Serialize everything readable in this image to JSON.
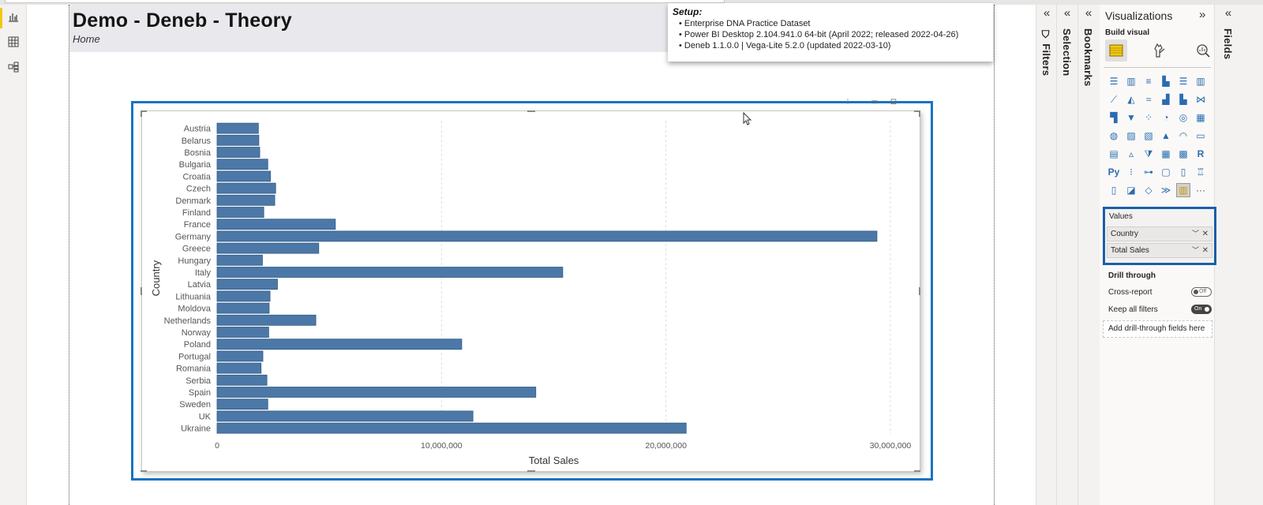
{
  "report": {
    "title": "Demo - Deneb - Theory",
    "subtitle": "Home"
  },
  "left_nav": [
    {
      "name": "report-view",
      "icon": "bar-chart-icon",
      "active": true
    },
    {
      "name": "data-view",
      "icon": "table-icon",
      "active": false
    },
    {
      "name": "model-view",
      "icon": "model-icon",
      "active": false
    }
  ],
  "setup_note": {
    "heading": "Setup:",
    "items": [
      "Enterprise DNA Practice Dataset",
      "Power BI Desktop 2.104.941.0 64-bit (April 2022; released 2022-04-26)",
      "Deneb 1.1.0.0 | Vega-Lite 5.2.0 (updated 2022-03-10)"
    ]
  },
  "visual_header": {
    "icons": [
      "filter-icon",
      "focus-mode-icon",
      "more-options-icon"
    ]
  },
  "panes": {
    "filters": {
      "label": "Filters",
      "collapse": "«"
    },
    "selection": {
      "label": "Selection",
      "collapse": "«"
    },
    "bookmarks": {
      "label": "Bookmarks",
      "collapse": "«"
    },
    "fields": {
      "label": "Fields",
      "collapse": "«"
    },
    "visualizations": {
      "title": "Visualizations",
      "expand": "»",
      "collapse": "«",
      "build_label": "Build visual",
      "tabs": [
        {
          "name": "fields-tab",
          "icon": "fields-icon",
          "active": true
        },
        {
          "name": "format-tab",
          "icon": "format-brush-icon",
          "active": false
        },
        {
          "name": "analytics-tab",
          "icon": "analytics-icon",
          "active": false
        }
      ],
      "visual_types": [
        "stacked-bar",
        "stacked-column",
        "clustered-bar",
        "clustered-column",
        "100-stacked-bar",
        "100-stacked-column",
        "line",
        "area",
        "stacked-area",
        "line-clustered-column",
        "line-stacked-column",
        "ribbon",
        "waterfall",
        "funnel",
        "scatter",
        "pie",
        "donut",
        "treemap",
        "map",
        "filled-map",
        "shape-map",
        "azure-map",
        "gauge",
        "card",
        "multi-row-card",
        "kpi",
        "slicer",
        "table",
        "matrix",
        "r-visual",
        "python-visual",
        "key-influencers",
        "decomposition-tree",
        "qa",
        "smart-narrative",
        "metrics",
        "paginated-report",
        "power-apps",
        "power-automate",
        "narrative",
        "deneb",
        "more"
      ],
      "selected_visual": "deneb",
      "values_label": "Values",
      "values_fields": [
        "Country",
        "Total Sales"
      ],
      "drill_through_label": "Drill through",
      "cross_report_label": "Cross-report",
      "cross_report_state": "Off",
      "keep_filters_label": "Keep all filters",
      "keep_filters_state": "On",
      "drill_drop_label": "Add drill-through fields here"
    }
  },
  "chart_data": {
    "type": "bar",
    "orientation": "horizontal",
    "title": "",
    "xlabel": "Total Sales",
    "ylabel": "Country",
    "xlim": [
      0,
      30000000
    ],
    "xticks": [
      0,
      10000000,
      20000000,
      30000000
    ],
    "xtick_labels": [
      "0",
      "10,000,000",
      "20,000,000",
      "30,000,000"
    ],
    "grid": "vertical dashed",
    "bar_color": "#4c78a8",
    "categories": [
      "Austria",
      "Belarus",
      "Bosnia",
      "Bulgaria",
      "Croatia",
      "Czech",
      "Denmark",
      "Finland",
      "France",
      "Germany",
      "Greece",
      "Hungary",
      "Italy",
      "Latvia",
      "Lithuania",
      "Moldova",
      "Netherlands",
      "Norway",
      "Poland",
      "Portugal",
      "Romania",
      "Serbia",
      "Spain",
      "Sweden",
      "UK",
      "Ukraine"
    ],
    "values": [
      1840000,
      1860000,
      1900000,
      2260000,
      2380000,
      2610000,
      2570000,
      2080000,
      5270000,
      29400000,
      4530000,
      2020000,
      15400000,
      2690000,
      2360000,
      2320000,
      4400000,
      2300000,
      10900000,
      2040000,
      1960000,
      2220000,
      14200000,
      2260000,
      11400000,
      20900000
    ]
  }
}
